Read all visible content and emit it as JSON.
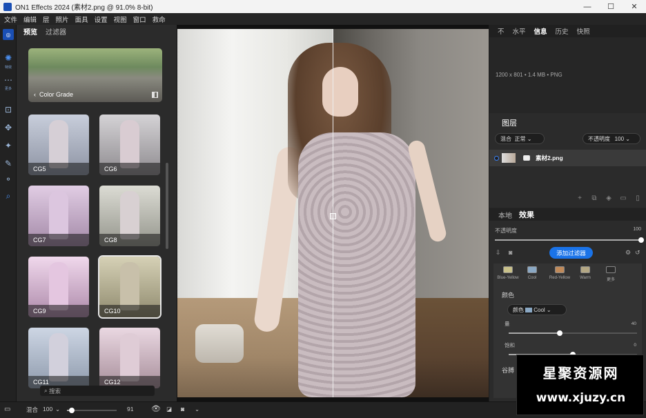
{
  "window": {
    "title": "ON1 Effects 2024 (素材2.png @ 91.0% 8-bit)",
    "controls": [
      "—",
      "☐",
      "✕"
    ]
  },
  "menu": [
    "文件",
    "编辑",
    "层",
    "照片",
    "面具",
    "设置",
    "视图",
    "窗口",
    "救命"
  ],
  "toolbar": {
    "tools": [
      {
        "icon": "effects-icon",
        "glyph": "✺",
        "label": "特效",
        "active": true
      },
      {
        "icon": "more-icon",
        "glyph": "⋯",
        "label": "更多"
      },
      {
        "icon": "crop-icon",
        "glyph": "⊡"
      },
      {
        "icon": "move-icon",
        "glyph": "✥"
      },
      {
        "icon": "magic-wand-icon",
        "glyph": "✦"
      },
      {
        "icon": "brush-icon",
        "glyph": "✎"
      },
      {
        "icon": "shapes-icon",
        "glyph": "⚬"
      },
      {
        "icon": "search-icon",
        "glyph": "⌕"
      }
    ]
  },
  "browser": {
    "tabs": [
      "预览",
      "过滤器"
    ],
    "category": "Color Grade",
    "presets": [
      "CG5",
      "CG6",
      "CG7",
      "CG8",
      "CG9",
      "CG10",
      "CG11",
      "CG12"
    ],
    "selected": "CG10",
    "search_placeholder": "搜索"
  },
  "right_tabs": [
    "不",
    "水平",
    "信息",
    "历史",
    "快照"
  ],
  "info": {
    "text": "1200 x 801 • 1.4 MB • PNG"
  },
  "layers": {
    "title": "图层",
    "blend_label": "混合",
    "blend_value": "正常",
    "opacity_label": "不透明度",
    "opacity_value": "100",
    "layer_name": "素材2.png"
  },
  "effects": {
    "tabs": [
      "本地",
      "效果"
    ],
    "opacity_label": "不透明度",
    "opacity_value": "100",
    "opacity_level": 1.0,
    "add_filter": "添加过滤器",
    "swatches": [
      {
        "label": "Blue-Yellow",
        "color": "#c9c18a"
      },
      {
        "label": "Cool",
        "color": "#8aa8c4"
      },
      {
        "label": "Red-Yellow",
        "color": "#c08a5a"
      },
      {
        "label": "Warm",
        "color": "#b3a784"
      },
      {
        "label": "更多",
        "color": "#2b2b2b"
      }
    ],
    "section": "颜色",
    "color_label": "颜色",
    "color_value": "Cool",
    "param1_label": "量",
    "param1_value": "40",
    "param1_level": 0.4,
    "param2_label": "饱和",
    "param2_value": "0",
    "param2_level": 0.5,
    "section2": "谷膊"
  },
  "bottom": {
    "blend_label": "混合",
    "blend_value": "100",
    "zoom_value": "91",
    "zoom_level": 0.1
  },
  "watermark": {
    "line1": "星聚资源网",
    "line2": "www.xjuzy.cn"
  }
}
